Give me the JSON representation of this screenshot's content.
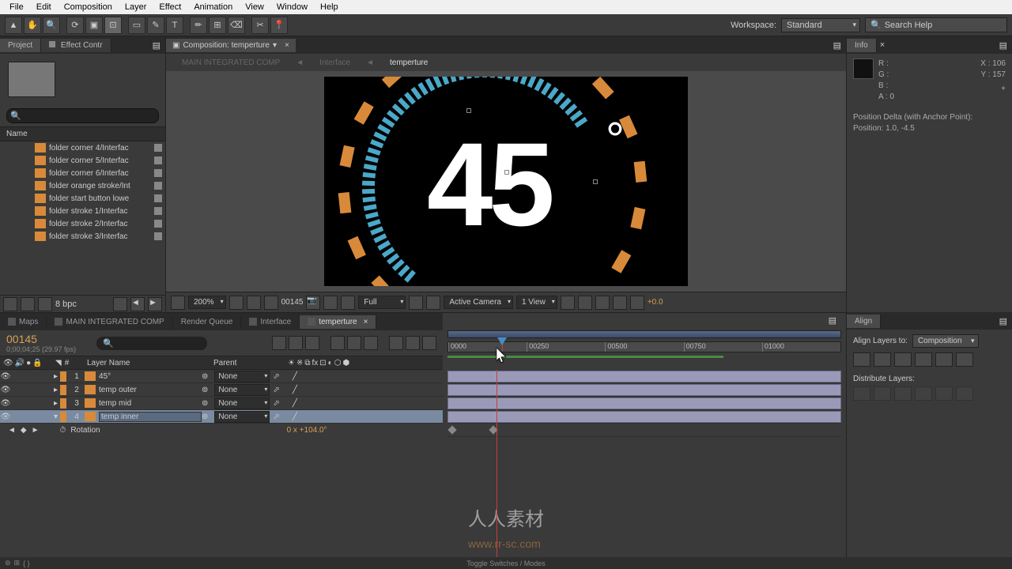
{
  "menu": [
    "File",
    "Edit",
    "Composition",
    "Layer",
    "Effect",
    "Animation",
    "View",
    "Window",
    "Help"
  ],
  "workspace": {
    "label": "Workspace:",
    "value": "Standard"
  },
  "search_help": {
    "placeholder": "Search Help"
  },
  "left_panel": {
    "tabs": [
      "Project",
      "Effect Contr"
    ],
    "name_header": "Name",
    "items": [
      "folder corner 4/Interfac",
      "folder corner 5/Interfac",
      "folder corner 6/Interfac",
      "folder orange stroke/Int",
      "folder start button lowe",
      "folder stroke 1/Interfac",
      "folder stroke 2/Interfac",
      "folder stroke 3/Interfac"
    ],
    "bpc": "8 bpc"
  },
  "composition": {
    "tab_label": "Composition: temperture",
    "breadcrumb": [
      "MAIN INTEGRATED COMP",
      "Interface",
      "temperture"
    ],
    "display_text": "45",
    "degree": "°"
  },
  "viewer_controls": {
    "zoom": "200%",
    "frame": "00145",
    "resolution": "Full",
    "camera": "Active Camera",
    "view": "1 View",
    "exposure": "+0.0"
  },
  "info_panel": {
    "title": "Info",
    "r": "R :",
    "g": "G :",
    "b": "B :",
    "a": "A :  0",
    "x": "X : 106",
    "y": "Y : 157",
    "delta_label": "Position Delta (with Anchor Point):",
    "delta_value": "Position: 1.0, -4.5"
  },
  "timeline": {
    "tabs": [
      "Maps",
      "MAIN INTEGRATED COMP",
      "Render Queue",
      "Interface",
      "temperture"
    ],
    "active_tab": 4,
    "timecode": "00145",
    "timecode_sub": "0;00;04;25 (29.97 fps)",
    "col_layer": "Layer Name",
    "col_parent": "Parent",
    "layers": [
      {
        "num": "1",
        "name": "45°",
        "parent": "None"
      },
      {
        "num": "2",
        "name": "temp outer",
        "parent": "None"
      },
      {
        "num": "3",
        "name": "temp mid",
        "parent": "None"
      },
      {
        "num": "4",
        "name": "temp inner",
        "parent": "None"
      }
    ],
    "selected_layer": 3,
    "property": {
      "name": "Rotation",
      "value": "0 x +104.0°"
    },
    "ruler": [
      "0000",
      "00250",
      "00500",
      "00750",
      "01000"
    ]
  },
  "align_panel": {
    "title": "Align",
    "layers_to": "Align Layers to:",
    "layers_to_value": "Composition",
    "distribute": "Distribute Layers:"
  },
  "statusbar": {
    "toggle": "Toggle Switches / Modes"
  },
  "watermark": {
    "text": "人人素材",
    "url": "www.rr-sc.com"
  }
}
